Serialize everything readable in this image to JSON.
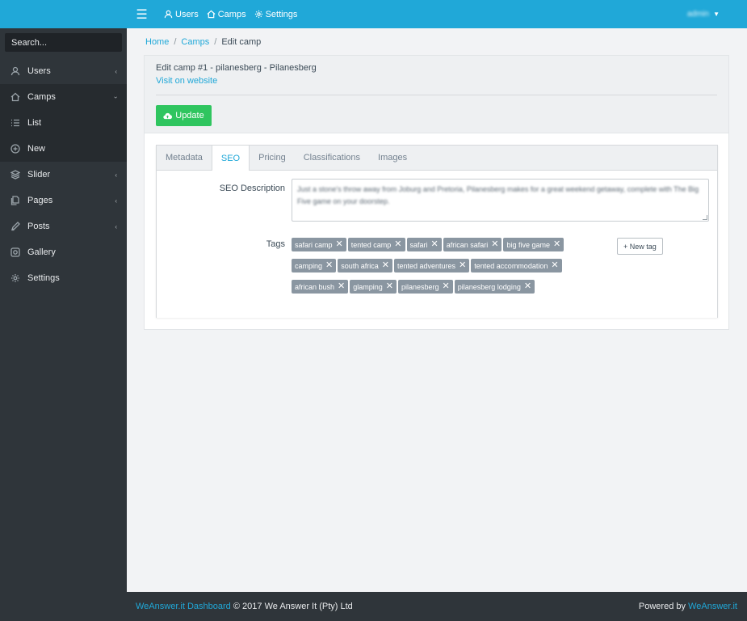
{
  "sidebar": {
    "search_placeholder": "Search...",
    "items": [
      {
        "label": "Users",
        "icon": "user-icon",
        "chevron": "‹"
      },
      {
        "label": "Camps",
        "icon": "home-icon",
        "chevron": "›"
      },
      {
        "label": "List",
        "icon": "list-icon",
        "chevron": ""
      },
      {
        "label": "New",
        "icon": "plus-circle-icon",
        "chevron": ""
      },
      {
        "label": "Slider",
        "icon": "layers-icon",
        "chevron": "‹"
      },
      {
        "label": "Pages",
        "icon": "pages-icon",
        "chevron": "‹"
      },
      {
        "label": "Posts",
        "icon": "pencil-icon",
        "chevron": "‹"
      },
      {
        "label": "Gallery",
        "icon": "image-icon",
        "chevron": ""
      },
      {
        "label": "Settings",
        "icon": "gear-icon",
        "chevron": ""
      }
    ]
  },
  "topbar": {
    "menu_icon": "hamburger-icon",
    "links": [
      {
        "label": "Users",
        "icon": "user-icon"
      },
      {
        "label": "Camps",
        "icon": "home-icon"
      },
      {
        "label": "Settings",
        "icon": "gear-icon"
      }
    ],
    "user": "admin"
  },
  "breadcrumb": {
    "home": "Home",
    "camps": "Camps",
    "current": "Edit camp",
    "separator": "/"
  },
  "card": {
    "title": "Edit camp #1 - pilanesberg - Pilanesberg",
    "link": "Visit on website",
    "update_label": "Update"
  },
  "tabs": [
    "Metadata",
    "SEO",
    "Pricing",
    "Classifications",
    "Images"
  ],
  "active_tab": "SEO",
  "seo": {
    "description_label": "SEO Description",
    "description_value": "Just a stone's throw away from Joburg and Pretoria, Pilanesberg makes for a great weekend getaway, complete with The Big Five game on your doorstep.",
    "tags_label": "Tags",
    "tags": [
      "safari camp",
      "tented camp",
      "safari",
      "african safari",
      "big five game",
      "camping",
      "south africa",
      "tented adventures",
      "tented accommodation",
      "african bush",
      "glamping",
      "pilanesberg",
      "pilanesberg lodging"
    ],
    "new_tag_label": "+ New tag"
  },
  "footer": {
    "brand": "WeAnswer.it Dashboard",
    "copyright": "© 2017 We Answer It (Pty) Ltd",
    "powered_by": "Powered by",
    "powered_link": "WeAnswer.it"
  },
  "colors": {
    "primary": "#20a8d8",
    "success": "#2fc55f",
    "sidebar": "#2f353a",
    "tag": "#8a96a1"
  }
}
